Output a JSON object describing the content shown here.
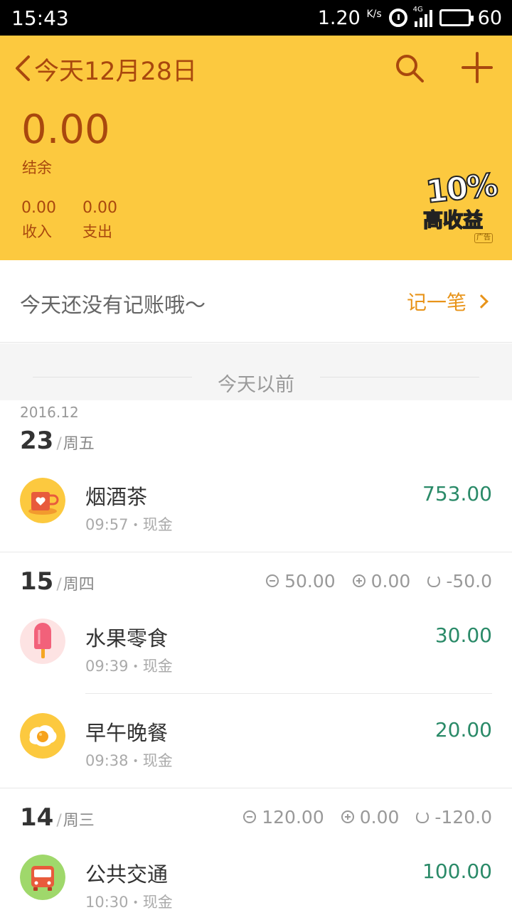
{
  "status_bar": {
    "time": "15:43",
    "speed": "1.20",
    "speed_unit": "K/s",
    "network": "4G",
    "battery": "60"
  },
  "header": {
    "title": "今天12月28日",
    "balance": "0.00",
    "balance_label": "结余",
    "income_value": "0.00",
    "income_label": "收入",
    "expense_value": "0.00",
    "expense_label": "支出",
    "background_color": "#fcc93f",
    "text_color": "#a9480e"
  },
  "ad": {
    "top_text": "10%",
    "main_text": "高收益",
    "tag": "广告"
  },
  "today": {
    "empty_text": "今天还没有记账哦～",
    "record_label": "记一笔",
    "accent_color": "#e8941a"
  },
  "section": {
    "label": "今天以前"
  },
  "list": {
    "month": "2016.12",
    "amount_color": "#2a8a68",
    "days": [
      {
        "day": "23",
        "weekday": "周五",
        "transactions": [
          {
            "icon": "cup-icon",
            "name": "烟酒茶",
            "time": "09:57",
            "account": "现金",
            "amount": "753.00"
          }
        ]
      },
      {
        "day": "15",
        "weekday": "周四",
        "expense": "50.00",
        "income": "0.00",
        "net": "-50.0",
        "transactions": [
          {
            "icon": "popsicle-icon",
            "name": "水果零食",
            "time": "09:39",
            "account": "现金",
            "amount": "30.00"
          },
          {
            "icon": "fried-egg-icon",
            "name": "早午晚餐",
            "time": "09:38",
            "account": "现金",
            "amount": "20.00"
          }
        ]
      },
      {
        "day": "14",
        "weekday": "周三",
        "expense": "120.00",
        "income": "0.00",
        "net": "-120.0",
        "transactions": [
          {
            "icon": "bus-icon",
            "name": "公共交通",
            "time": "10:30",
            "account": "现金",
            "amount": "100.00"
          }
        ]
      }
    ]
  }
}
